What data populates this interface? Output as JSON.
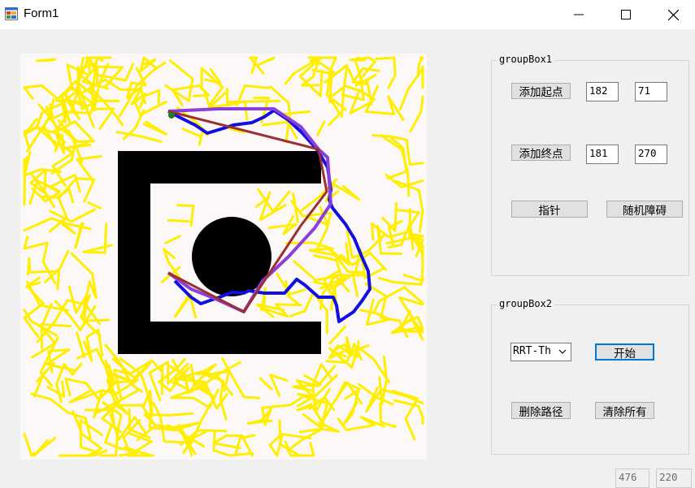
{
  "window": {
    "title": "Form1",
    "icon": "winforms-app-icon"
  },
  "titlebar_buttons": [
    "minimize-icon",
    "maximize-icon",
    "close-icon"
  ],
  "groupBox1": {
    "legend": "groupBox1",
    "add_start_label": "添加起点",
    "start_x": "182",
    "start_y": "71",
    "add_goal_label": "添加终点",
    "goal_x": "181",
    "goal_y": "270",
    "pointer_label": "指针",
    "random_obstacle_label": "随机障碍"
  },
  "groupBox2": {
    "legend": "groupBox2",
    "algorithm_selected": "RRT-Th",
    "start_button_label": "开始",
    "delete_path_label": "删除路径",
    "clear_all_label": "清除所有"
  },
  "status": {
    "value_a": "476",
    "value_b": "220"
  },
  "colors": {
    "tree": "#ffee00",
    "path_blue": "#1010e0",
    "path_purple": "#8a3fd8",
    "path_brown": "#9b3030",
    "obstacle": "#000000",
    "start_marker": "#1e7d1e",
    "canvas_bg": "#fdf8f8"
  }
}
